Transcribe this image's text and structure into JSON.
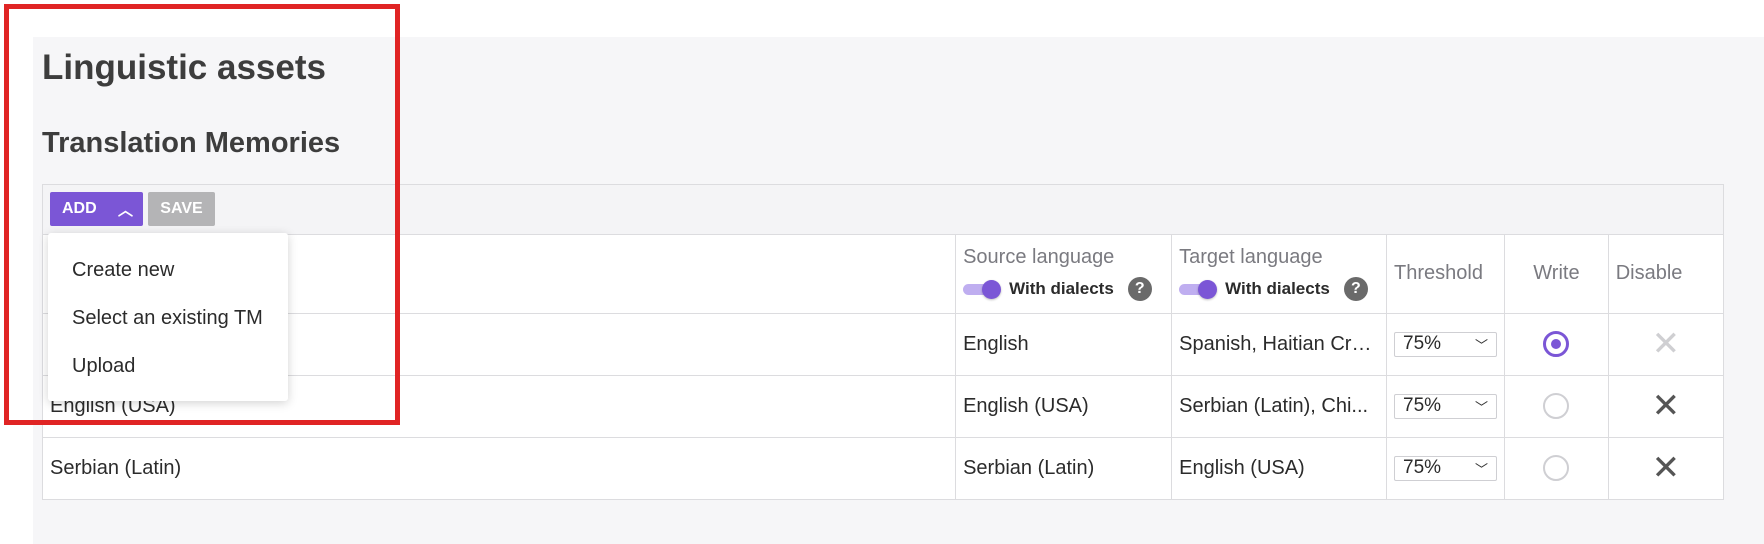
{
  "page": {
    "title": "Linguistic assets",
    "section_title": "Translation Memories"
  },
  "toolbar": {
    "add_label": "ADD",
    "save_label": "SAVE"
  },
  "add_menu": {
    "items": [
      "Create new",
      "Select an existing TM",
      "Upload"
    ]
  },
  "table": {
    "headers": {
      "source_language": "Source language",
      "target_language": "Target language",
      "with_dialects": "With dialects",
      "help": "?",
      "threshold": "Threshold",
      "write": "Write",
      "disable": "Disable"
    },
    "rows": [
      {
        "name": "",
        "source": "English",
        "target": "Spanish, Haitian Cre...",
        "threshold": "75%",
        "write": true
      },
      {
        "name": "English (USA)",
        "source": "English (USA)",
        "target": "Serbian (Latin), Chi...",
        "threshold": "75%",
        "write": false
      },
      {
        "name": "Serbian (Latin)",
        "source": "Serbian (Latin)",
        "target": "English (USA)",
        "threshold": "75%",
        "write": false
      }
    ]
  },
  "colors": {
    "accent": "#7b56d6",
    "save_disabled": "#b4b4b6",
    "highlight": "#e02424"
  }
}
